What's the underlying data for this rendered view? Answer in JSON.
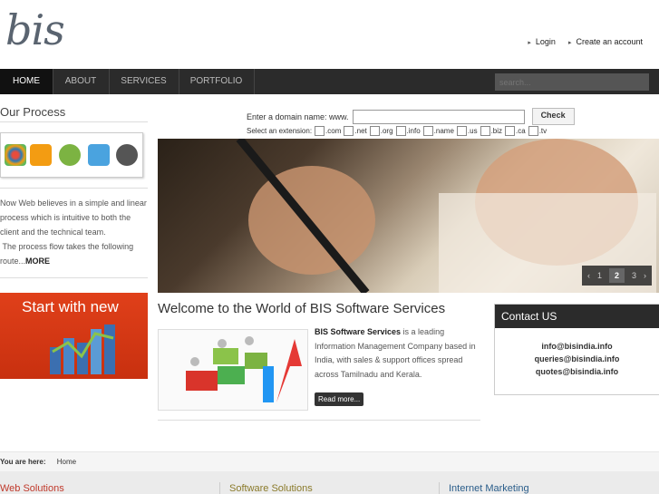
{
  "header": {
    "logo": "bis",
    "links": [
      "Login",
      "Create an account"
    ]
  },
  "nav": {
    "items": [
      "HOME",
      "ABOUT",
      "SERVICES",
      "PORTFOLIO"
    ],
    "search_placeholder": "search..."
  },
  "sidebar": {
    "title": "Our Process",
    "process_text": "Now Web believes in a simple and linear process which is intuitive to both the client and the technical team.",
    "process_text2": "The process flow takes the following route...",
    "more": "MORE",
    "banner_text": "Start with new"
  },
  "domain": {
    "label": "Enter a domain name: www.",
    "button": "Check",
    "ext_label": "Select an extension:",
    "extensions": [
      ".com",
      ".net",
      ".org",
      ".info",
      ".name",
      ".us",
      ".biz",
      ".ca",
      ".tv"
    ]
  },
  "slider": {
    "pages": [
      "1",
      "2",
      "3"
    ],
    "active_page": "2",
    "prev": "‹",
    "next": "›"
  },
  "welcome": {
    "title": "Welcome to the World of BIS Software Services",
    "company": "BIS Software Services",
    "text": " is a leading Information Management Company based in India, with sales & support offices spread across Tamilnadu and Kerala.",
    "read_more": "Read more..."
  },
  "contact": {
    "title": "Contact US",
    "emails": [
      "info@bisindia.info",
      "queries@bisindia.info",
      "quotes@bisindia.info"
    ]
  },
  "breadcrumb": {
    "label": "You are here:",
    "current": "Home"
  },
  "footer": {
    "columns": [
      "Web Solutions",
      "Software Solutions",
      "Internet Marketing"
    ]
  },
  "colors": {
    "nav_bg": "#2b2b2b",
    "accent_red": "#c8300f",
    "footer_web": "#c0392b",
    "footer_software": "#8a7a2a",
    "footer_internet": "#2a5d8a"
  }
}
